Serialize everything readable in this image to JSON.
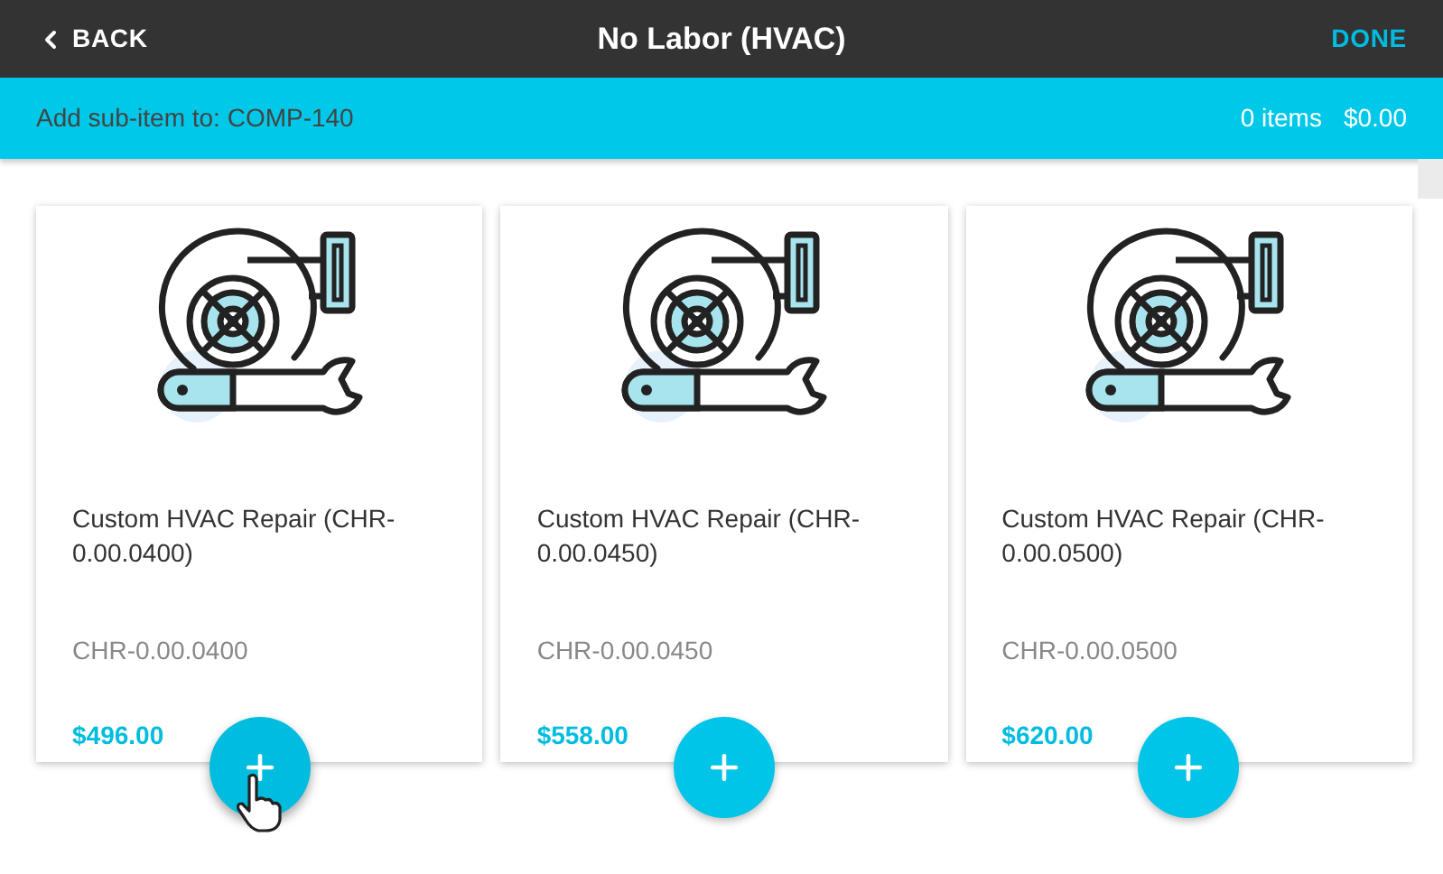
{
  "header": {
    "back": "BACK",
    "title": "No Labor (HVAC)",
    "done": "DONE"
  },
  "sub_bar": {
    "label": "Add sub-item to: COMP-140",
    "count": "0 items",
    "total": "$0.00"
  },
  "items": [
    {
      "name": "Custom HVAC Repair (CHR-0.00.0400)",
      "code": "CHR-0.00.0400",
      "price": "$496.00",
      "hovered": true
    },
    {
      "name": "Custom HVAC Repair (CHR-0.00.0450)",
      "code": "CHR-0.00.0450",
      "price": "$558.00",
      "hovered": false
    },
    {
      "name": "Custom HVAC Repair (CHR-0.00.0500)",
      "code": "CHR-0.00.0500",
      "price": "$620.00",
      "hovered": false
    }
  ]
}
